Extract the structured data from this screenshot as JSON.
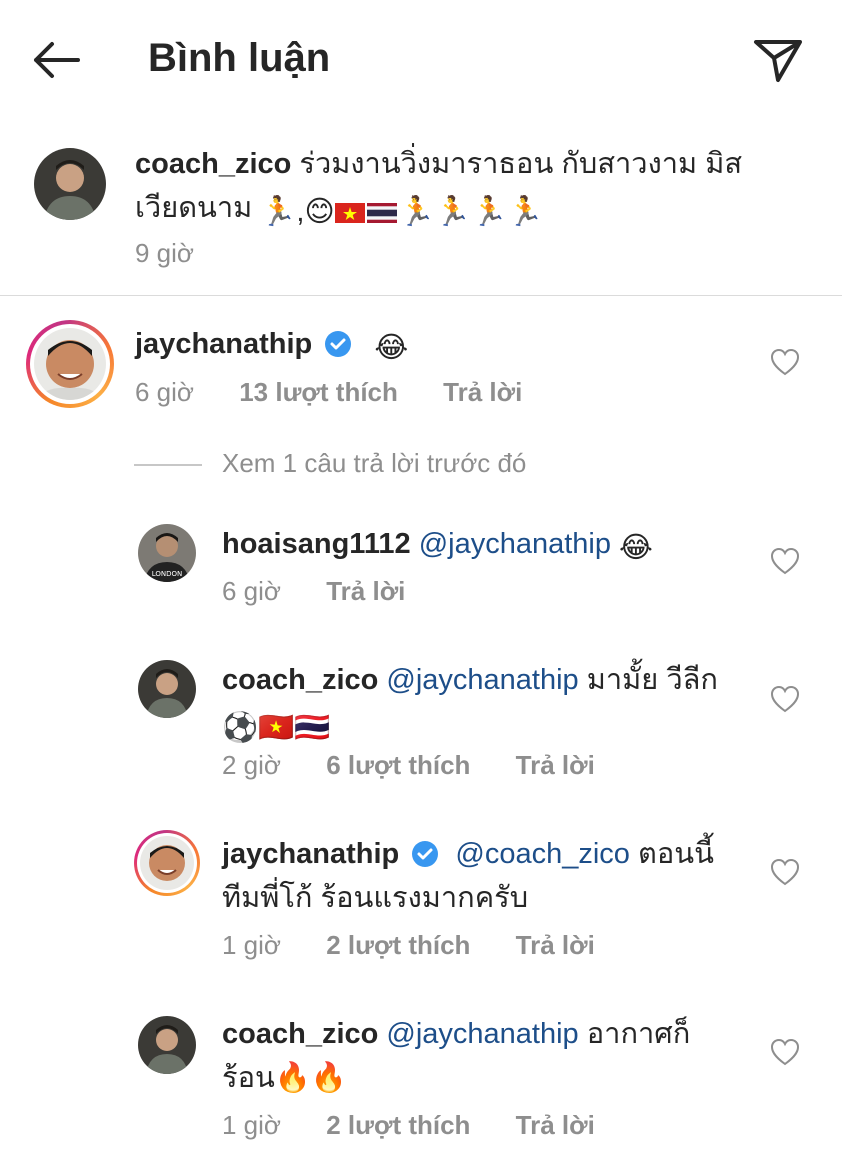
{
  "header": {
    "title": "Bình luận",
    "back_icon": "arrow-left-icon",
    "share_icon": "send-icon"
  },
  "caption": {
    "username": "coach_zico",
    "text_line1": "ร่วมงานวิ่งมาราธอน กับสาวงาม มิส",
    "text_line2": "เวียดนาม",
    "emoji": [
      "🏃",
      ",",
      "😊",
      "🇻🇳",
      "🇹🇭",
      "🏃",
      "🏃",
      "🏃",
      "🏃"
    ],
    "time": "9 giờ"
  },
  "comment": {
    "username": "jaychanathip",
    "verified": true,
    "text": "😂",
    "time": "6 giờ",
    "likes": "13 lượt thích",
    "reply_label": "Trả lời"
  },
  "view_previous": "Xem 1 câu trả lời trước đó",
  "replies": [
    {
      "username": "hoaisang1112",
      "mention": "@jaychanathip",
      "text": "😂",
      "time": "6 giờ",
      "likes": "",
      "reply_label": "Trả lời"
    },
    {
      "username": "coach_zico",
      "mention": "@jaychanathip",
      "text_line1": "มามั้ย วีลีก",
      "text_line2": "⚽🇻🇳🇹🇭",
      "time": "2 giờ",
      "likes": "6 lượt thích",
      "reply_label": "Trả lời"
    },
    {
      "username": "jaychanathip",
      "verified": true,
      "mention": "@coach_zico",
      "text_line1": "ตอนนี้",
      "text_line2": "ทีมพี่โก้ ร้อนแรงมากครับ",
      "time": "1 giờ",
      "likes": "2 lượt thích",
      "reply_label": "Trả lời"
    },
    {
      "username": "coach_zico",
      "mention": "@jaychanathip",
      "text_line1": "อากาศก็",
      "text_line2": "ร้อน🔥🔥",
      "time": "1 giờ",
      "likes": "2 lượt thích",
      "reply_label": "Trả lời"
    }
  ],
  "colors": {
    "mention": "#1d4e89",
    "meta": "#8e8e8e",
    "verified": "#3897f0"
  }
}
